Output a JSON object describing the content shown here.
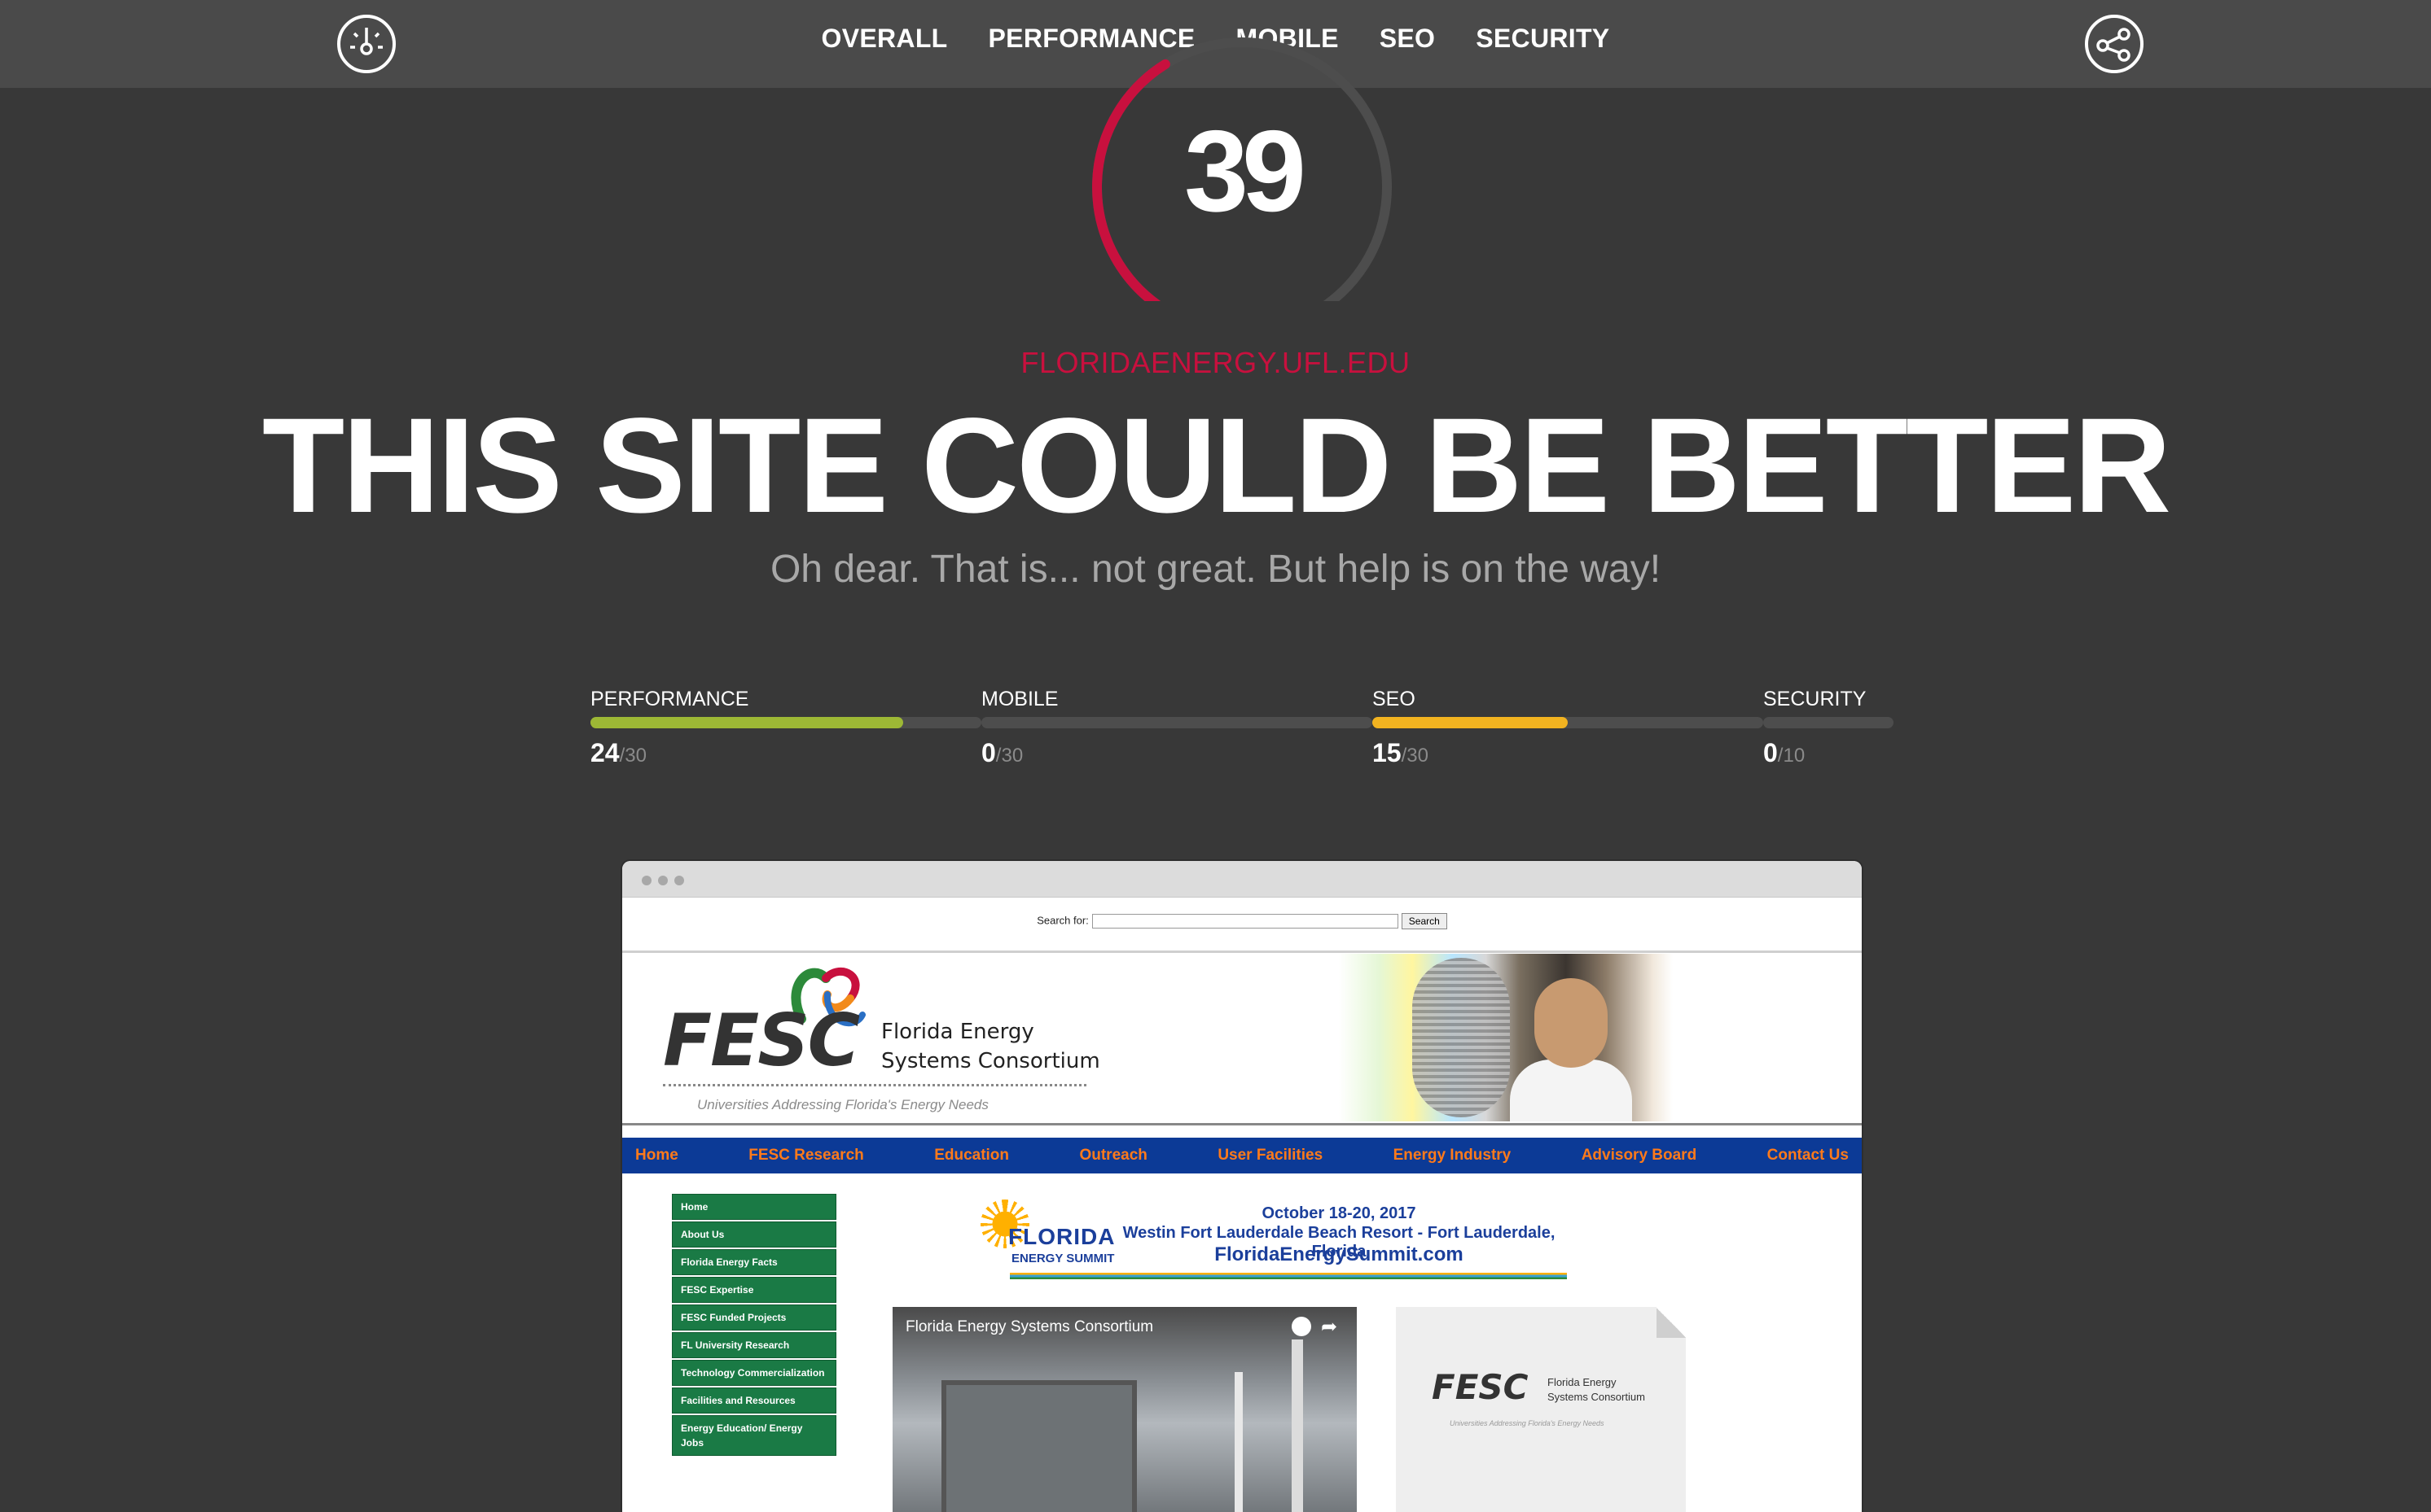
{
  "nav": {
    "items": [
      "OVERALL",
      "PERFORMANCE",
      "MOBILE",
      "SEO",
      "SECURITY"
    ]
  },
  "score": {
    "value": "39",
    "fraction": 0.39
  },
  "domain": "FLORIDAENERGY.UFL.EDU",
  "headline": "THIS SITE COULD BE BETTER",
  "subline": "Oh dear. That is... not great. But help is on the way!",
  "categories": [
    {
      "label": "PERFORMANCE",
      "score": "24",
      "max": "/30",
      "fraction": 0.8,
      "color": "#9db835"
    },
    {
      "label": "MOBILE",
      "score": "0",
      "max": "/30",
      "fraction": 0,
      "color": "#9db835"
    },
    {
      "label": "SEO",
      "score": "15",
      "max": "/30",
      "fraction": 0.5,
      "color": "#f2b320"
    },
    {
      "label": "SECURITY",
      "score": "0",
      "max": "/10",
      "fraction": 0,
      "color": "#9db835"
    }
  ],
  "colors": {
    "accent": "#c8103e",
    "background": "#383838",
    "topbar": "#4a4a4a"
  },
  "icons": {
    "logo": "speedometer-icon",
    "share": "share-icon"
  },
  "preview": {
    "search_label": "Search for:",
    "search_button": "Search",
    "logo_text": "FESC",
    "org_line1": "Florida Energy",
    "org_line2": "Systems Consortium",
    "tagline": "Universities Addressing Florida's Energy Needs",
    "top_menu": [
      "Home",
      "FESC Research",
      "Education",
      "Outreach",
      "User Facilities",
      "Energy Industry",
      "Advisory Board",
      "Contact Us"
    ],
    "side_menu": [
      "Home",
      "About Us",
      "Florida Energy Facts",
      "FESC Expertise",
      "FESC Funded Projects",
      "FL University Research",
      "Technology Commercialization",
      "Facilities and Resources",
      "Energy Education/ Energy Jobs"
    ],
    "summit": {
      "brand1": "FLORIDA",
      "brand2": "ENERGY SUMMIT",
      "dates": "October 18-20, 2017",
      "venue": "Westin Fort Lauderdale Beach Resort - Fort Lauderdale, Florida",
      "url": "FloridaEnergySummit.com"
    },
    "video_title": "Florida Energy Systems Consortium",
    "doc": {
      "logo_text": "FESC",
      "line1": "Florida Energy",
      "line2": "Systems Consortium",
      "tagline": "Universities Addressing Florida's Energy Needs"
    }
  }
}
